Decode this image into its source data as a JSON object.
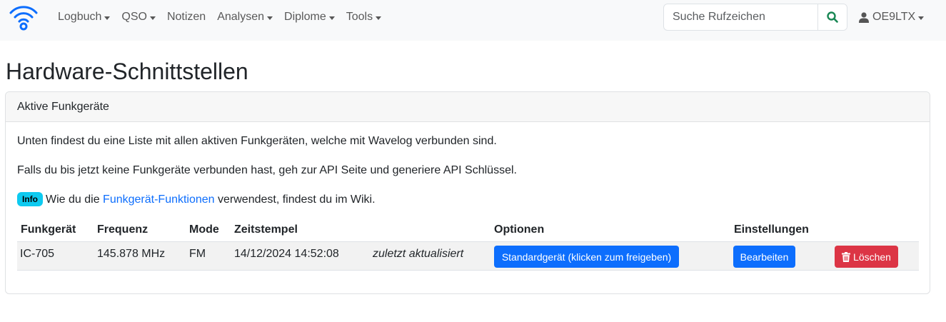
{
  "navbar": {
    "items": [
      {
        "label": "Logbuch",
        "dropdown": true
      },
      {
        "label": "QSO",
        "dropdown": true
      },
      {
        "label": "Notizen",
        "dropdown": false
      },
      {
        "label": "Analysen",
        "dropdown": true
      },
      {
        "label": "Diplome",
        "dropdown": true
      },
      {
        "label": "Tools",
        "dropdown": true
      }
    ],
    "search": {
      "placeholder": "Suche Rufzeichen",
      "value": ""
    },
    "user": "OE9LTX"
  },
  "page": {
    "title": "Hardware-Schnittstellen",
    "card_title": "Aktive Funkgeräte",
    "intro1": "Unten findest du eine Liste mit allen aktiven Funkgeräten, welche mit Wavelog verbunden sind.",
    "intro2": "Falls du bis jetzt keine Funkgeräte verbunden hast, geh zur API Seite und generiere API Schlüssel.",
    "info_badge": "Info",
    "info_pre": "Wie du die ",
    "info_link": "Funkgerät-Funktionen",
    "info_post": " verwendest, findest du im Wiki."
  },
  "table": {
    "headers": {
      "radio": "Funkgerät",
      "frequency": "Frequenz",
      "mode": "Mode",
      "timestamp": "Zeitstempel",
      "options": "Optionen",
      "settings": "Einstellungen"
    },
    "rows": [
      {
        "radio": "IC-705",
        "frequency": "145.878 MHz",
        "mode": "FM",
        "timestamp": "14/12/2024 14:52:08",
        "status": "zuletzt aktualisiert",
        "default_button": "Standardgerät (klicken zum freigeben)",
        "edit_button": "Bearbeiten",
        "delete_button": "Löschen"
      }
    ]
  },
  "colors": {
    "primary": "#0d6efd",
    "danger": "#dc3545",
    "info": "#0dcaf0",
    "search_icon": "#198754",
    "logo": "#0d6efd"
  },
  "icons": {
    "logo": "wifi-icon",
    "search": "search-icon",
    "user": "user-icon",
    "delete": "trash-icon"
  }
}
